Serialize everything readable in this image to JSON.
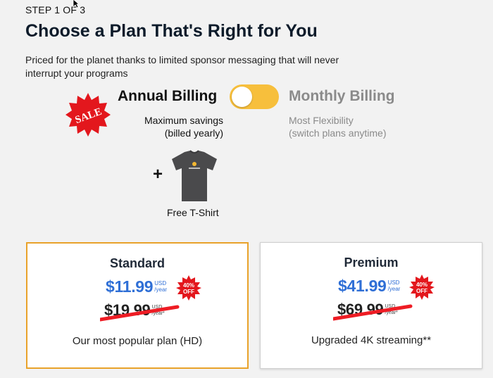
{
  "header": {
    "step": "STEP 1 OF 3",
    "title": "Choose a Plan That's Right for You",
    "subtitle": "Priced for the planet thanks to limited sponsor messaging that will never interrupt your programs"
  },
  "billing": {
    "sale_badge": "SALE",
    "annual_label": "Annual Billing",
    "annual_desc_1": "Maximum savings",
    "annual_desc_2": "(billed yearly)",
    "monthly_label": "Monthly Billing",
    "monthly_desc_1": "Most Flexibility",
    "monthly_desc_2": "(switch plans anytime)",
    "toggle_state": "annual"
  },
  "bonus": {
    "plus": "+",
    "label": "Free T-Shirt"
  },
  "plans": [
    {
      "name": "Standard",
      "price": "$11.99",
      "currency": "USD",
      "period": "/year",
      "old_price": "$19.99",
      "old_currency": "USD",
      "old_period": "/year*",
      "discount_pct": "40%",
      "discount_word": "OFF",
      "description": "Our most popular plan (HD)"
    },
    {
      "name": "Premium",
      "price": "$41.99",
      "currency": "USD",
      "period": "/year",
      "old_price": "$69.99",
      "old_currency": "USD",
      "old_period": "/year*",
      "discount_pct": "40%",
      "discount_word": "OFF",
      "description": "Upgraded 4K streaming**"
    }
  ],
  "colors": {
    "toggle": "#f7bf3c",
    "accent_blue": "#2f6fd6",
    "sale_red": "#e3171d",
    "selected_border": "#e9a22a"
  }
}
